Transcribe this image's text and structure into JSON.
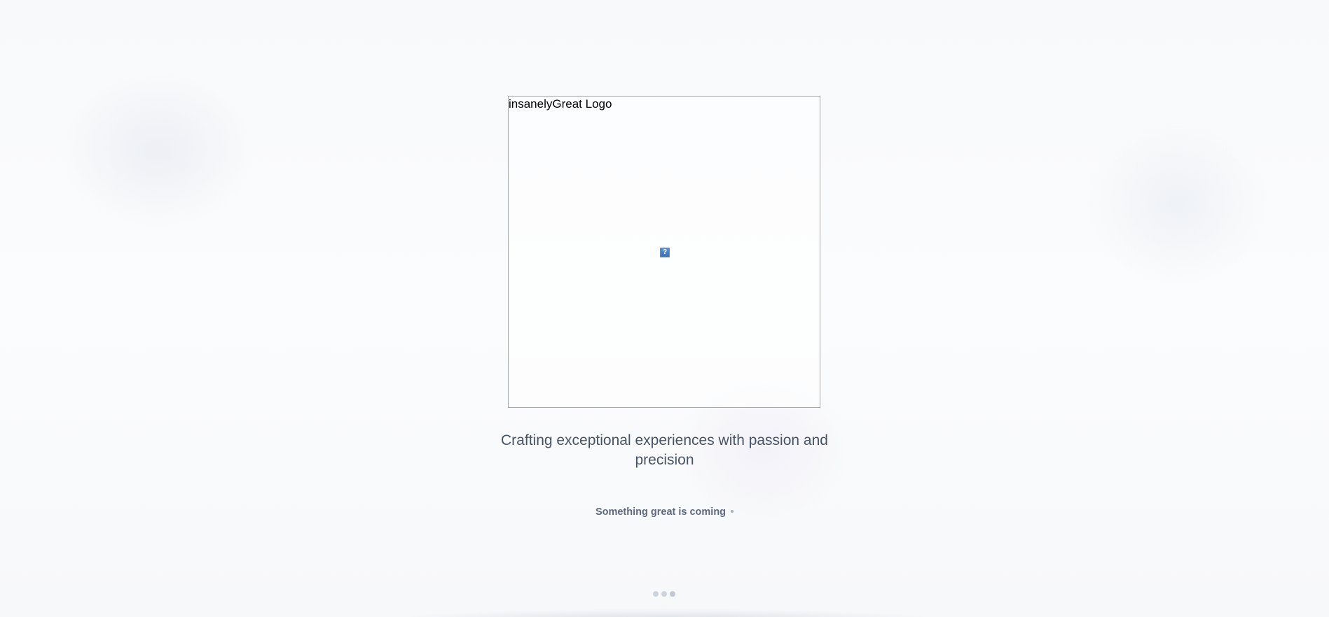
{
  "logo": {
    "alt_text": "insanelyGreat Logo",
    "broken_image_icon": "broken-image-icon"
  },
  "tagline": "Crafting exceptional experiences with passion and precision",
  "status": {
    "text": "Something great is coming"
  },
  "loader": {
    "dot_count": 3
  }
}
